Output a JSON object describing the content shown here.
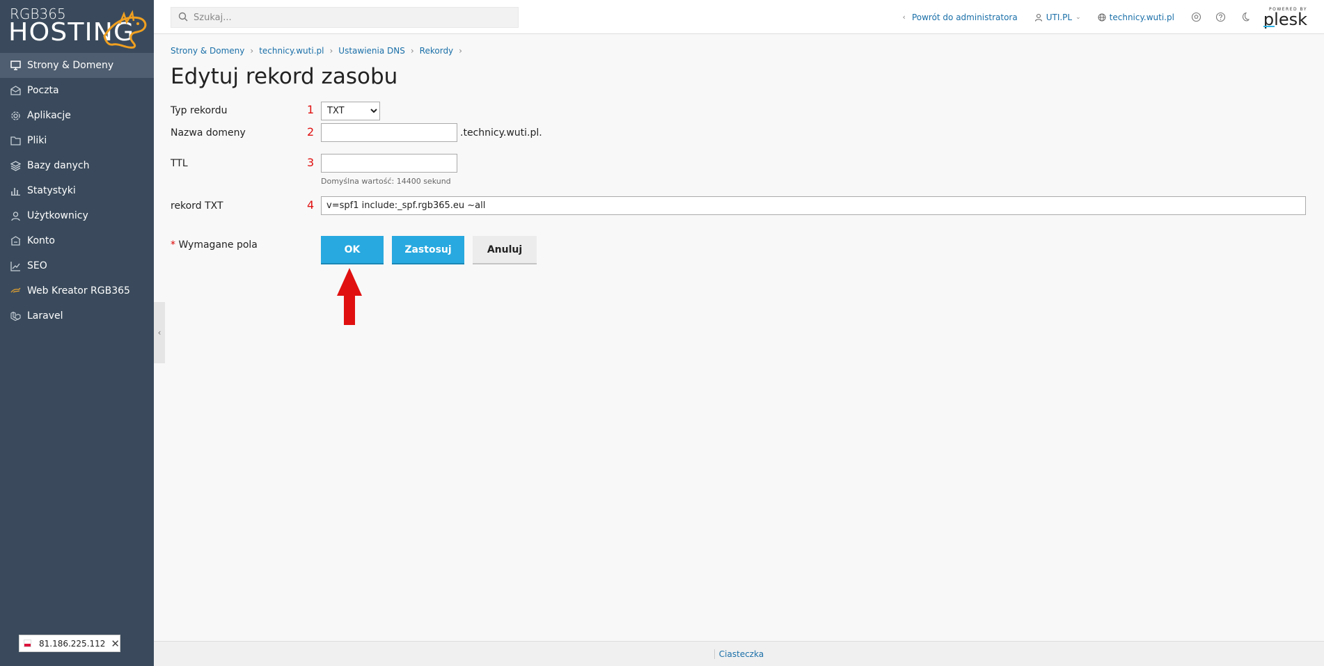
{
  "brand": {
    "top": "RGB365",
    "main": "HOSTING"
  },
  "sidebar": {
    "items": [
      {
        "label": "Strony & Domeny",
        "icon": "monitor-icon",
        "active": true
      },
      {
        "label": "Poczta",
        "icon": "mail-icon"
      },
      {
        "label": "Aplikacje",
        "icon": "gear-icon"
      },
      {
        "label": "Pliki",
        "icon": "folder-icon"
      },
      {
        "label": "Bazy danych",
        "icon": "layers-icon"
      },
      {
        "label": "Statystyki",
        "icon": "bar-chart-icon"
      },
      {
        "label": "Użytkownicy",
        "icon": "user-icon"
      },
      {
        "label": "Konto",
        "icon": "account-icon"
      },
      {
        "label": "SEO",
        "icon": "trend-icon"
      },
      {
        "label": "Web Kreator RGB365",
        "icon": "dragon-icon"
      },
      {
        "label": "Laravel",
        "icon": "laravel-icon"
      }
    ],
    "ip": "81.186.225.112"
  },
  "header": {
    "search_placeholder": "Szukaj...",
    "back_admin": "Powrót do administratora",
    "user": "UTI.PL",
    "domain": "technicy.wuti.pl",
    "powered_by": "POWERED BY",
    "plesk": "plesk"
  },
  "breadcrumb": [
    "Strony & Domeny",
    "technicy.wuti.pl",
    "Ustawienia DNS",
    "Rekordy"
  ],
  "page_title": "Edytuj rekord zasobu",
  "form": {
    "type_label": "Typ rekordu",
    "type_value": "TXT",
    "name_label": "Nazwa domeny",
    "name_value": "",
    "name_suffix": ".technicy.wuti.pl.",
    "ttl_label": "TTL",
    "ttl_value": "",
    "ttl_hint": "Domyślna wartość: 14400 sekund",
    "txt_label": "rekord TXT",
    "txt_value": "v=spf1 include:_spf.rgb365.eu ~all",
    "required_star": "*",
    "required_label": "Wymagane pola",
    "numbers": [
      "1",
      "2",
      "3",
      "4"
    ]
  },
  "buttons": {
    "ok": "OK",
    "apply": "Zastosuj",
    "cancel": "Anuluj"
  },
  "footer": {
    "cookies": "Ciasteczka"
  },
  "colors": {
    "sidebar": "#3a4a5c",
    "accent": "#28a9df",
    "link": "#1a6fa8",
    "annotation": "#e01010"
  }
}
